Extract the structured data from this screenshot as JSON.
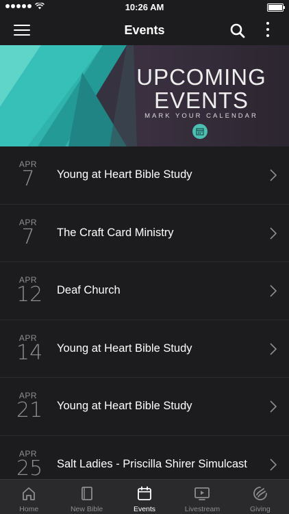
{
  "status_bar": {
    "time": "10:26 AM"
  },
  "nav": {
    "title": "Events"
  },
  "banner": {
    "line1": "UPCOMING",
    "line2": "EVENTS",
    "subtitle": "MARK YOUR CALENDAR"
  },
  "events": [
    {
      "month": "APR",
      "day": "7",
      "title": "Young at Heart Bible Study"
    },
    {
      "month": "APR",
      "day": "7",
      "title": "The Craft Card Ministry"
    },
    {
      "month": "APR",
      "day": "12",
      "title": "Deaf Church"
    },
    {
      "month": "APR",
      "day": "14",
      "title": "Young at Heart Bible Study"
    },
    {
      "month": "APR",
      "day": "21",
      "title": "Young at Heart Bible Study"
    },
    {
      "month": "APR",
      "day": "25",
      "title": "Salt Ladies - Priscilla Shirer Simulcast"
    }
  ],
  "tabs": [
    {
      "label": "Home",
      "icon": "home-icon",
      "active": false
    },
    {
      "label": "New Bible",
      "icon": "book-icon",
      "active": false
    },
    {
      "label": "Events",
      "icon": "calendar-icon",
      "active": true
    },
    {
      "label": "Livestream",
      "icon": "video-icon",
      "active": false
    },
    {
      "label": "Giving",
      "icon": "giving-icon",
      "active": false
    }
  ],
  "colors": {
    "background": "#1c1c1e",
    "accent": "#4bbfb2",
    "tab_bar": "#2a2a2c"
  }
}
